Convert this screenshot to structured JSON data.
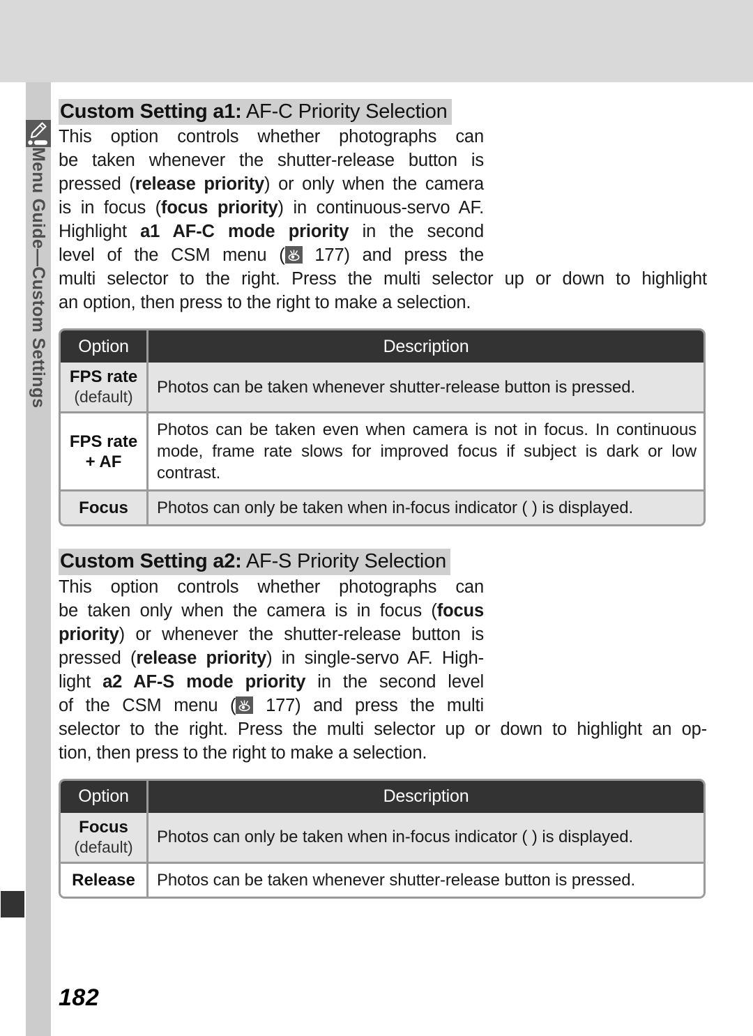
{
  "sidebar": {
    "tab_label": "Menu Guide—Custom Settings",
    "icon_name": "pencil-icon"
  },
  "page": {
    "number": "182"
  },
  "sections": [
    {
      "heading_bold": "Custom Setting a1:",
      "heading_rest": " AF-C Priority Selection",
      "paragraph_lines_narrow": [
        "This option controls whether photographs can",
        "be taken whenever the shutter-release button is",
        "pressed (release priority) or only when the camera",
        "is in focus (focus priority) in continuous-servo AF.",
        "Highlight a1 AF-C mode priority in the second",
        "level of the CSM menu ( 177) and press the"
      ],
      "paragraph_lines_wide": [
        "multi selector to the right.  Press the multi selector up or down to highlight",
        "an option, then press to the right to make a selection."
      ],
      "table": {
        "headers": [
          "Option",
          "Description"
        ],
        "rows": [
          {
            "option": "FPS rate",
            "option_note": "(default)",
            "description": "Photos can be taken whenever shutter-release button is pressed.",
            "shaded": true
          },
          {
            "option_line1": "FPS rate",
            "option_line2": "+ AF",
            "description": "Photos can be taken even when camera is not in focus.  In continuous mode, frame rate slows for improved focus if subject is dark or low contrast.",
            "shaded": false
          },
          {
            "option": "Focus",
            "description": "Photos can only be taken when in-focus indicator (  ) is displayed.",
            "shaded": true
          }
        ]
      }
    },
    {
      "heading_bold": "Custom Setting a2:",
      "heading_rest": " AF-S Priority Selection",
      "paragraph_lines_narrow": [
        "This option controls whether photographs can",
        "be taken only when the camera is in focus (focus",
        "priority) or whenever the shutter-release button is",
        "pressed (release priority) in single-servo AF.  High-",
        "light a2 AF-S mode priority in the second level",
        "of the CSM menu ( 177) and press the multi"
      ],
      "paragraph_lines_wide": [
        "selector to the right.  Press the multi selector up or down to highlight an op-",
        "tion, then press to the right to make a selection."
      ],
      "table": {
        "headers": [
          "Option",
          "Description"
        ],
        "rows": [
          {
            "option": "Focus",
            "option_note": "(default)",
            "description": "Photos can only be taken when in-focus indicator (  ) is displayed.",
            "shaded": true
          },
          {
            "option": "Release",
            "description": "Photos can be taken whenever shutter-release button is pressed.",
            "shaded": false
          }
        ]
      }
    }
  ],
  "colors": {
    "top_band": "#d9d9d9",
    "rail": "#cccccc",
    "tab_dark": "#595959",
    "table_header": "#333333",
    "table_border": "#9a9a9a",
    "row_shade": "#e4e4e4",
    "heading_highlight": "#cfcfcf"
  }
}
